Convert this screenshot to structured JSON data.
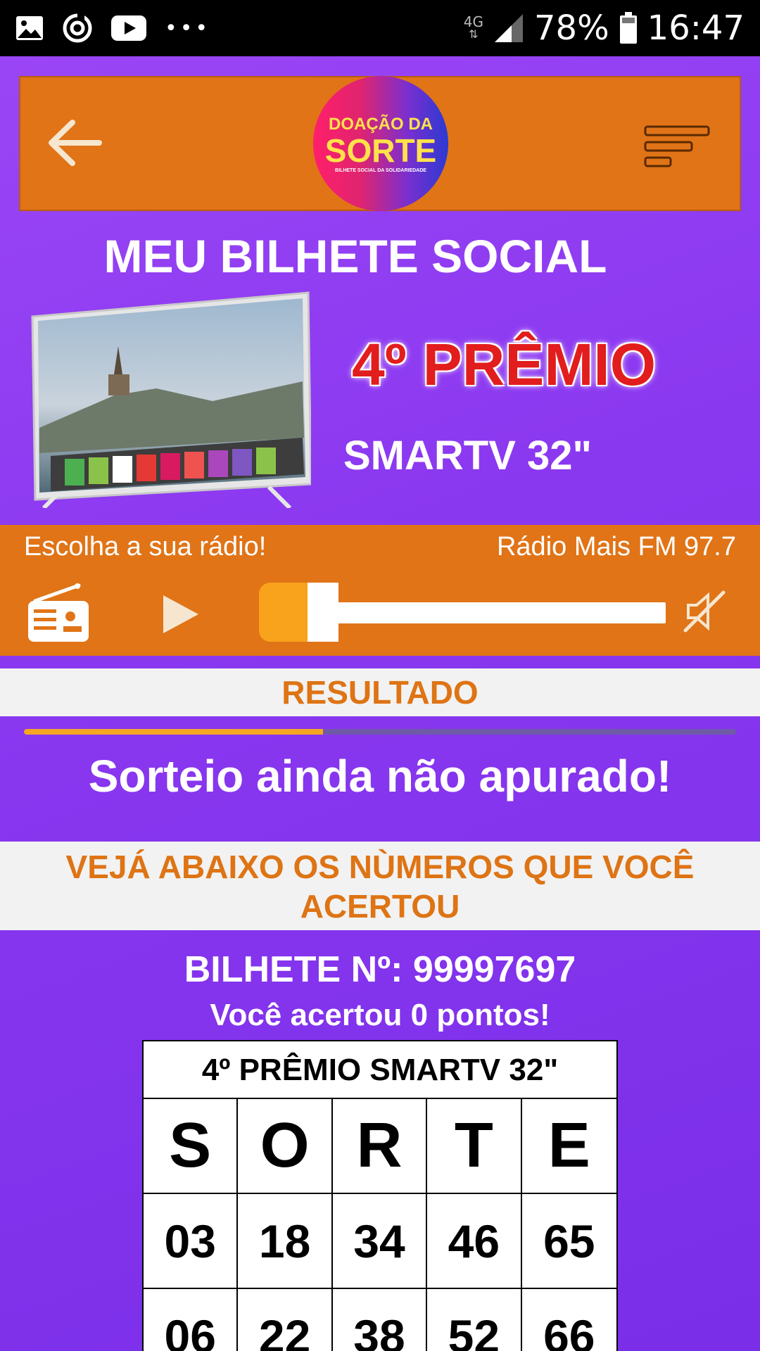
{
  "status_bar": {
    "network": "4G",
    "battery": "78%",
    "time": "16:47"
  },
  "header": {
    "logo_line1": "DOAÇÃO DA",
    "logo_line2": "SORTE",
    "logo_line3": "BILHETE SOCIAL DA SOLIDARIEDADE"
  },
  "page_title": "MEU BILHETE SOCIAL",
  "prize": {
    "title": "4º PRÊMIO",
    "name": "SMARTV 32\""
  },
  "radio": {
    "label": "Escolha a sua rádio!",
    "station": "Rádio Mais FM 97.7",
    "volume_fraction": 0.12
  },
  "result": {
    "heading": "RESULTADO",
    "progress_fraction": 0.42,
    "message": "Sorteio ainda não apurado!",
    "see_below": "VEJÁ ABAIXO  OS NÙMEROS  QUE VOCÊ ACERTOU"
  },
  "ticket": {
    "number_label": "BILHETE Nº: 99997697",
    "points_label": "Você acertou 0 pontos!",
    "card_title": "4º PRÊMIO SMARTV 32\"",
    "letters": [
      "S",
      "O",
      "R",
      "T",
      "E"
    ],
    "rows": [
      [
        "03",
        "18",
        "34",
        "46",
        "65"
      ],
      [
        "06",
        "22",
        "38",
        "52",
        "66"
      ]
    ]
  },
  "colors": {
    "background": "#8a3df2",
    "accent_orange": "#e07417",
    "prize_red": "#e21d1d"
  }
}
